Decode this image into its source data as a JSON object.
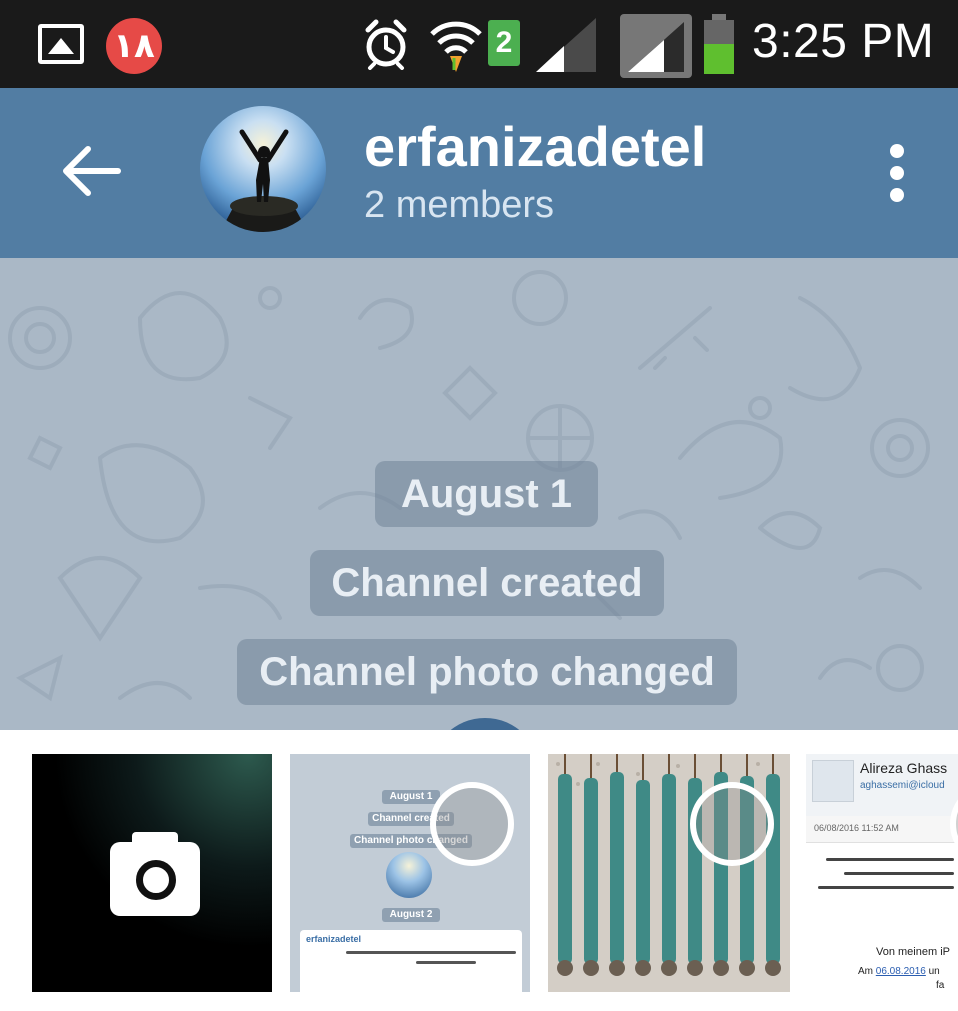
{
  "status_bar": {
    "notification_badge": "١٨",
    "sim_slot": "2",
    "time": "3:25 PM",
    "icons": [
      "gallery-icon",
      "alarm-icon",
      "wifi-icon",
      "signal-icon",
      "battery-icon"
    ]
  },
  "app_bar": {
    "title": "erfanizadetel",
    "subtitle": "2 members",
    "icons": [
      "back-arrow-icon",
      "more-vert-icon"
    ],
    "color": "#527da3"
  },
  "chat": {
    "background_color": "#aab8c6",
    "service_messages": [
      "August 1",
      "Channel created",
      "Channel photo changed"
    ]
  },
  "photo_picker": {
    "thumbnails": [
      {
        "kind": "camera",
        "icon": "camera-icon"
      },
      {
        "kind": "screenshot",
        "texts": [
          "August 1",
          "Channel created",
          "Channel photo changed",
          "August 2"
        ],
        "sender": "erfanizadetel"
      },
      {
        "kind": "photo"
      },
      {
        "kind": "email",
        "sender": "Alireza Ghass",
        "address": "aghassemi@icloud",
        "date": "06/08/2016  11:52 AM",
        "von": "Von meinem iP",
        "am_prefix": "Am ",
        "am_date": "06.08.2016",
        "am_suffix": " un",
        "fa": "fa"
      }
    ]
  }
}
